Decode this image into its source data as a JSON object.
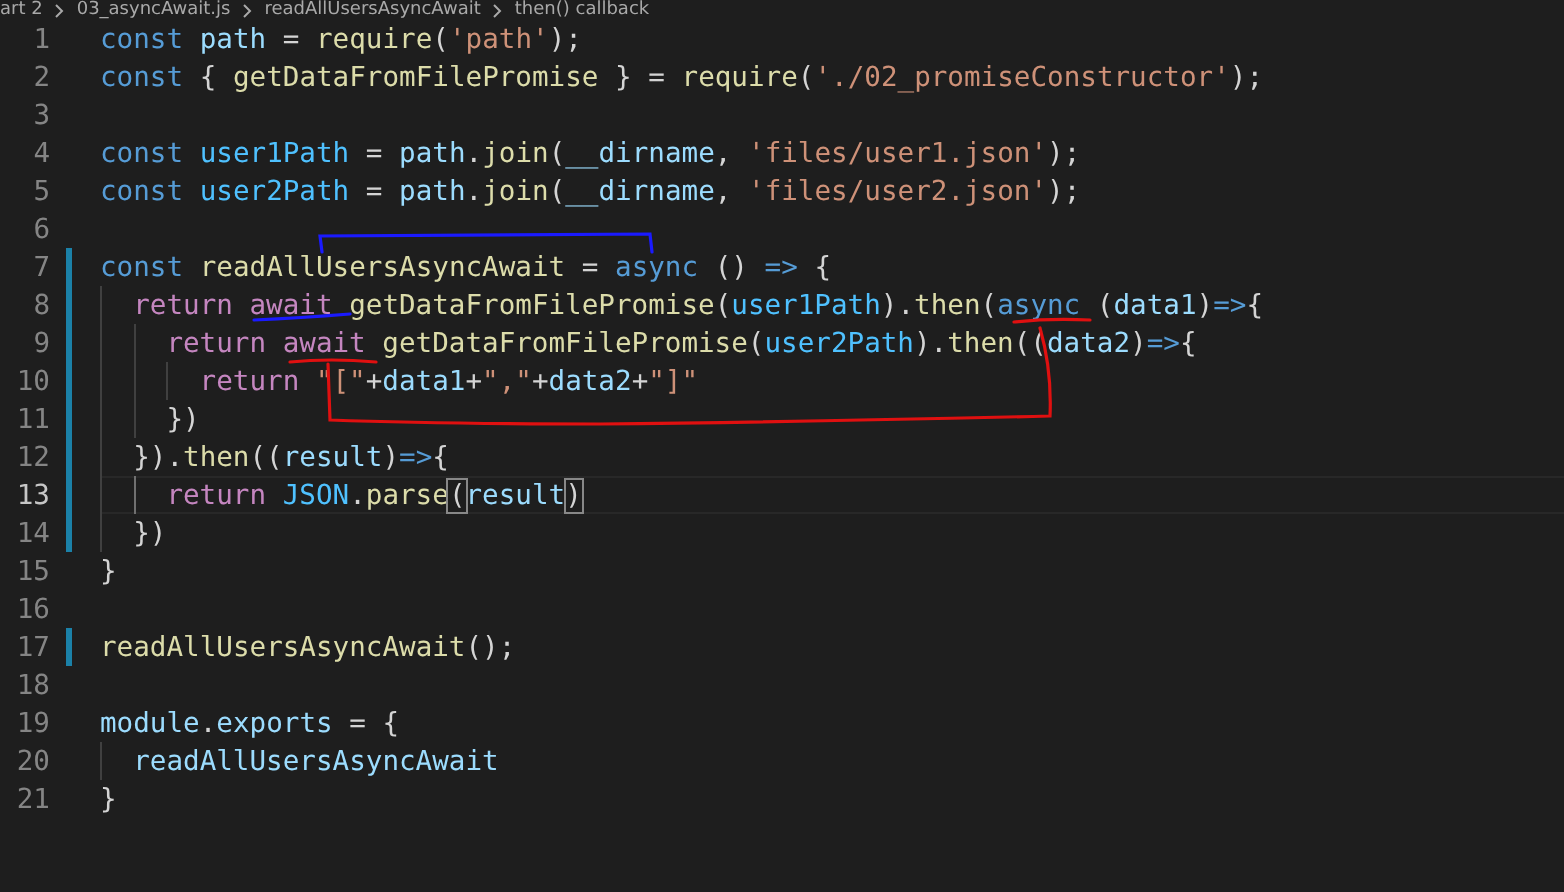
{
  "breadcrumb": [
    "art 2",
    "03_asyncAwait.js",
    "readAllUsersAsyncAwait",
    "then() callback"
  ],
  "lines": [
    {
      "number": "1",
      "modified": false,
      "active": false,
      "tokens": [
        {
          "kind": "keyword",
          "text": "const "
        },
        {
          "kind": "variable",
          "text": "path"
        },
        {
          "kind": "plain",
          "text": " = "
        },
        {
          "kind": "function",
          "text": "require"
        },
        {
          "kind": "plain",
          "text": "("
        },
        {
          "kind": "string",
          "text": "'path'"
        },
        {
          "kind": "plain",
          "text": ");"
        }
      ]
    },
    {
      "number": "2",
      "modified": false,
      "active": false,
      "tokens": [
        {
          "kind": "keyword",
          "text": "const "
        },
        {
          "kind": "plain",
          "text": "{ "
        },
        {
          "kind": "function",
          "text": "getDataFromFilePromise"
        },
        {
          "kind": "plain",
          "text": " } = "
        },
        {
          "kind": "function",
          "text": "require"
        },
        {
          "kind": "plain",
          "text": "("
        },
        {
          "kind": "string",
          "text": "'./02_promiseConstructor'"
        },
        {
          "kind": "plain",
          "text": ");"
        }
      ]
    },
    {
      "number": "3",
      "modified": false,
      "active": false
    },
    {
      "number": "4",
      "modified": false,
      "active": false,
      "tokens": [
        {
          "kind": "keyword",
          "text": "const "
        },
        {
          "kind": "constant",
          "text": "user1Path"
        },
        {
          "kind": "plain",
          "text": " = "
        },
        {
          "kind": "variable",
          "text": "path"
        },
        {
          "kind": "plain",
          "text": "."
        },
        {
          "kind": "function",
          "text": "join"
        },
        {
          "kind": "plain",
          "text": "("
        },
        {
          "kind": "variable",
          "text": "__dirname"
        },
        {
          "kind": "plain",
          "text": ", "
        },
        {
          "kind": "string",
          "text": "'files/user1.json'"
        },
        {
          "kind": "plain",
          "text": ");"
        }
      ]
    },
    {
      "number": "5",
      "modified": false,
      "active": false,
      "tokens": [
        {
          "kind": "keyword",
          "text": "const "
        },
        {
          "kind": "constant",
          "text": "user2Path"
        },
        {
          "kind": "plain",
          "text": " = "
        },
        {
          "kind": "variable",
          "text": "path"
        },
        {
          "kind": "plain",
          "text": "."
        },
        {
          "kind": "function",
          "text": "join"
        },
        {
          "kind": "plain",
          "text": "("
        },
        {
          "kind": "variable",
          "text": "__dirname"
        },
        {
          "kind": "plain",
          "text": ", "
        },
        {
          "kind": "string",
          "text": "'files/user2.json'"
        },
        {
          "kind": "plain",
          "text": ");"
        }
      ]
    },
    {
      "number": "6",
      "modified": false,
      "active": false
    },
    {
      "number": "7",
      "modified": true,
      "active": false,
      "tokens": [
        {
          "kind": "keyword",
          "text": "const "
        },
        {
          "kind": "function",
          "text": "readAllUsersAsyncAwait"
        },
        {
          "kind": "plain",
          "text": " = "
        },
        {
          "kind": "keyword",
          "text": "async"
        },
        {
          "kind": "plain",
          "text": " () "
        },
        {
          "kind": "keyword",
          "text": "=>"
        },
        {
          "kind": "plain",
          "text": " {"
        }
      ]
    },
    {
      "number": "8",
      "modified": true,
      "active": false,
      "guides": [
        {
          "active": false
        }
      ],
      "tokens": [
        {
          "kind": "control",
          "text": "return await "
        },
        {
          "kind": "function",
          "text": "getDataFromFilePromise"
        },
        {
          "kind": "plain",
          "text": "("
        },
        {
          "kind": "constant",
          "text": "user1Path"
        },
        {
          "kind": "plain",
          "text": ")."
        },
        {
          "kind": "function",
          "text": "then"
        },
        {
          "kind": "plain",
          "text": "("
        },
        {
          "kind": "keyword",
          "text": "async"
        },
        {
          "kind": "plain",
          "text": " ("
        },
        {
          "kind": "variable",
          "text": "data1"
        },
        {
          "kind": "plain",
          "text": ")"
        },
        {
          "kind": "keyword",
          "text": "=>"
        },
        {
          "kind": "plain",
          "text": "{"
        }
      ]
    },
    {
      "number": "9",
      "modified": true,
      "active": false,
      "guides": [
        {
          "active": false
        },
        {
          "active": false
        }
      ],
      "tokens": [
        {
          "kind": "control",
          "text": "return await "
        },
        {
          "kind": "function",
          "text": "getDataFromFilePromise"
        },
        {
          "kind": "plain",
          "text": "("
        },
        {
          "kind": "constant",
          "text": "user2Path"
        },
        {
          "kind": "plain",
          "text": ")."
        },
        {
          "kind": "function",
          "text": "then"
        },
        {
          "kind": "plain",
          "text": "(("
        },
        {
          "kind": "variable",
          "text": "data2"
        },
        {
          "kind": "plain",
          "text": ")"
        },
        {
          "kind": "keyword",
          "text": "=>"
        },
        {
          "kind": "plain",
          "text": "{"
        }
      ]
    },
    {
      "number": "10",
      "modified": true,
      "active": false,
      "guides": [
        {
          "active": false
        },
        {
          "active": false
        },
        {
          "active": false
        }
      ],
      "tokens": [
        {
          "kind": "control",
          "text": "return "
        },
        {
          "kind": "string",
          "text": "\"[\""
        },
        {
          "kind": "plain",
          "text": "+"
        },
        {
          "kind": "variable",
          "text": "data1"
        },
        {
          "kind": "plain",
          "text": "+"
        },
        {
          "kind": "string",
          "text": "\",\""
        },
        {
          "kind": "plain",
          "text": "+"
        },
        {
          "kind": "variable",
          "text": "data2"
        },
        {
          "kind": "plain",
          "text": "+"
        },
        {
          "kind": "string",
          "text": "\"]\""
        }
      ]
    },
    {
      "number": "11",
      "modified": true,
      "active": false,
      "guides": [
        {
          "active": false
        },
        {
          "active": false
        }
      ],
      "tokens": [
        {
          "kind": "plain",
          "text": "})"
        }
      ]
    },
    {
      "number": "12",
      "modified": true,
      "active": false,
      "guides": [
        {
          "active": false
        }
      ],
      "tokens": [
        {
          "kind": "plain",
          "text": "})."
        },
        {
          "kind": "function",
          "text": "then"
        },
        {
          "kind": "plain",
          "text": "(("
        },
        {
          "kind": "variable",
          "text": "result"
        },
        {
          "kind": "plain",
          "text": ")"
        },
        {
          "kind": "keyword",
          "text": "=>"
        },
        {
          "kind": "plain",
          "text": "{"
        }
      ]
    },
    {
      "number": "13",
      "modified": true,
      "active": true,
      "guides": [
        {
          "active": false
        },
        {
          "active": true
        }
      ],
      "tokens": [
        {
          "kind": "control",
          "text": "return "
        },
        {
          "kind": "constant",
          "text": "JSON"
        },
        {
          "kind": "plain",
          "text": "."
        },
        {
          "kind": "function",
          "text": "parse"
        },
        {
          "kind": "bracket_match",
          "text": "("
        },
        {
          "kind": "variable",
          "text": "result"
        },
        {
          "kind": "bracket_match",
          "text": ")"
        }
      ]
    },
    {
      "number": "14",
      "modified": true,
      "active": false,
      "guides": [
        {
          "active": false
        }
      ],
      "tokens": [
        {
          "kind": "plain",
          "text": "})"
        }
      ]
    },
    {
      "number": "15",
      "modified": false,
      "active": false,
      "tokens": [
        {
          "kind": "plain",
          "text": "}"
        }
      ]
    },
    {
      "number": "16",
      "modified": false,
      "active": false
    },
    {
      "number": "17",
      "modified": true,
      "active": false,
      "tokens": [
        {
          "kind": "function",
          "text": "readAllUsersAsyncAwait"
        },
        {
          "kind": "plain",
          "text": "();"
        }
      ]
    },
    {
      "number": "18",
      "modified": false,
      "active": false
    },
    {
      "number": "19",
      "modified": false,
      "active": false,
      "tokens": [
        {
          "kind": "variable",
          "text": "module"
        },
        {
          "kind": "plain",
          "text": "."
        },
        {
          "kind": "variable",
          "text": "exports"
        },
        {
          "kind": "plain",
          "text": " = {"
        }
      ]
    },
    {
      "number": "20",
      "modified": false,
      "active": false,
      "guides": [
        {
          "active": false
        }
      ],
      "tokens": [
        {
          "kind": "variable",
          "text": "readAllUsersAsyncAwait"
        }
      ]
    },
    {
      "number": "21",
      "modified": false,
      "active": false,
      "tokens": [
        {
          "kind": "plain",
          "text": "}"
        }
      ]
    }
  ]
}
